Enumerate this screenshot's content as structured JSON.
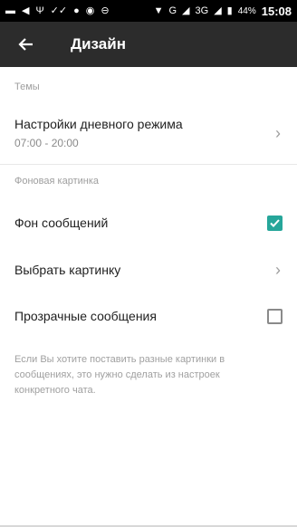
{
  "status_bar": {
    "icons": [
      "message-icon",
      "send-icon",
      "usb-icon",
      "check-icon",
      "chat-icon",
      "skype-icon",
      "minus-icon",
      "wifi-icon",
      "signal-icon",
      "signal-icon",
      "battery-icon"
    ],
    "network_g": "G",
    "network_3g": "3G",
    "battery": "44%",
    "time": "15:08"
  },
  "app_bar": {
    "title": "Дизайн",
    "background": "#2c2c2c"
  },
  "sections": {
    "themes": {
      "header": "Темы",
      "day_mode": {
        "title": "Настройки дневного режима",
        "subtitle": "07:00 - 20:00"
      }
    },
    "wallpaper": {
      "header": "Фоновая картинка",
      "message_background": {
        "title": "Фон сообщений",
        "checked": true
      },
      "choose_image": {
        "title": "Выбрать картинку"
      },
      "transparent_messages": {
        "title": "Прозрачные сообщения",
        "checked": false
      },
      "footnote": "Если Вы хотите поставить разные картинки в сообщениях, это нужно сделать из настроек конкретного чата."
    }
  },
  "colors": {
    "accent": "#26a69a",
    "status_bar": "#000000"
  }
}
